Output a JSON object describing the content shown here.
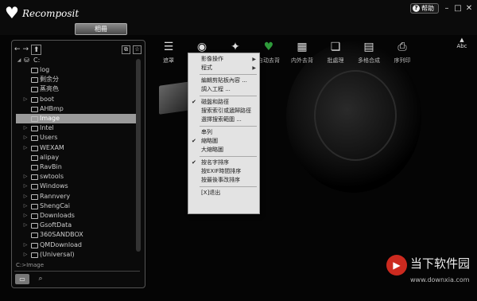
{
  "app": {
    "title": "Recomposit",
    "help_label": "帮助",
    "mode_button": "相冊"
  },
  "window_buttons": [
    "–",
    "□",
    "✕"
  ],
  "nav": {
    "back": "←",
    "forward": "→",
    "up": "⬆"
  },
  "panel_tools": [
    "⧉",
    "☆"
  ],
  "tree": {
    "root": "C:",
    "items": [
      {
        "label": "log",
        "expander": ""
      },
      {
        "label": "剩余分",
        "expander": ""
      },
      {
        "label": "蒸亮色",
        "expander": ""
      },
      {
        "label": "boot",
        "expander": "▷"
      },
      {
        "label": "AHBmp",
        "expander": ""
      },
      {
        "label": "Image",
        "expander": "",
        "selected": true
      },
      {
        "label": "Intel",
        "expander": "▷"
      },
      {
        "label": "Users",
        "expander": "▷"
      },
      {
        "label": "WEXAM",
        "expander": "▷"
      },
      {
        "label": "alipay",
        "expander": ""
      },
      {
        "label": "RavBin",
        "expander": ""
      },
      {
        "label": "swtools",
        "expander": "▷"
      },
      {
        "label": "Windows",
        "expander": "▷"
      },
      {
        "label": "Rannvery",
        "expander": "▷"
      },
      {
        "label": "ShengCai",
        "expander": "▷"
      },
      {
        "label": "Downloads",
        "expander": "▷"
      },
      {
        "label": "GsoftData",
        "expander": "▷"
      },
      {
        "label": "360SANDBOX",
        "expander": ""
      },
      {
        "label": "QMDownload",
        "expander": "▷"
      },
      {
        "label": "(Universal)",
        "expander": "▷"
      }
    ]
  },
  "path_label": "C:>Image",
  "toolbar": [
    {
      "label": "遮罩",
      "icon": "document-list-icon"
    },
    {
      "label": "",
      "icon": "eye-icon"
    },
    {
      "label": "",
      "icon": "wand-icon"
    },
    {
      "label": "自动去背",
      "icon": "heart-green-icon"
    },
    {
      "label": "内外去背",
      "icon": "grid-icon"
    },
    {
      "label": "批處理",
      "icon": "batch-icon"
    },
    {
      "label": "多格合成",
      "icon": "multi-frame-icon"
    },
    {
      "label": "序列印",
      "icon": "printer-icon"
    }
  ],
  "sort_label": "Abc",
  "menu": {
    "items": [
      {
        "label": "影像操作",
        "submenu": true
      },
      {
        "label": "程式",
        "submenu": true
      },
      {
        "sep": true
      },
      {
        "label": "編輯剪貼板內容 ..."
      },
      {
        "label": "調入工程 ..."
      },
      {
        "sep": true
      },
      {
        "label": "磁盤和路徑",
        "checked": true
      },
      {
        "label": "搜索索引或遞歸路徑"
      },
      {
        "label": "選擇搜索範圍 ..."
      },
      {
        "sep": true
      },
      {
        "label": "串列"
      },
      {
        "label": "縮略圖",
        "checked": true
      },
      {
        "label": "大縮略圖"
      },
      {
        "sep": true
      },
      {
        "label": "按名字排序",
        "checked": true
      },
      {
        "label": "按EXIF時間排序"
      },
      {
        "label": "按最後事改排序"
      },
      {
        "sep": true
      },
      {
        "label": "[X]退出"
      }
    ]
  },
  "watermark": {
    "text": "当下软件园",
    "url": "www.downxia.com"
  }
}
